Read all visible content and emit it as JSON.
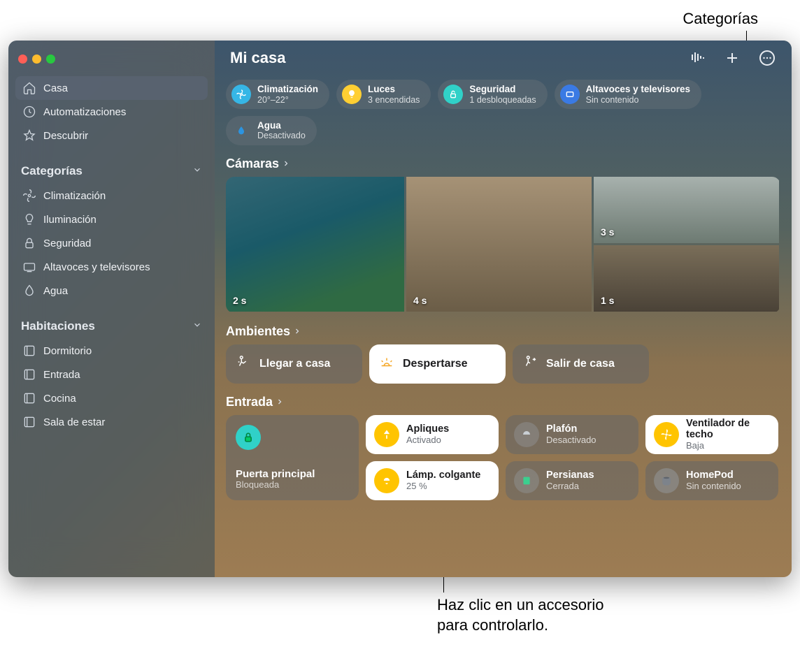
{
  "callouts": {
    "categories": "Categorías",
    "accessory": "Haz clic en un accesorio\npara controlarlo."
  },
  "header": {
    "title": "Mi casa"
  },
  "sidebar": {
    "nav": [
      {
        "label": "Casa",
        "icon": "home"
      },
      {
        "label": "Automatizaciones",
        "icon": "clock"
      },
      {
        "label": "Descubrir",
        "icon": "star"
      }
    ],
    "sections": {
      "cat_title": "Categorías",
      "rooms_title": "Habitaciones"
    },
    "categories": [
      {
        "label": "Climatización",
        "icon": "fan"
      },
      {
        "label": "Iluminación",
        "icon": "bulb"
      },
      {
        "label": "Seguridad",
        "icon": "lock"
      },
      {
        "label": "Altavoces y televisores",
        "icon": "tv"
      },
      {
        "label": "Agua",
        "icon": "drop"
      }
    ],
    "rooms": [
      {
        "label": "Dormitorio"
      },
      {
        "label": "Entrada"
      },
      {
        "label": "Cocina"
      },
      {
        "label": "Sala de estar"
      }
    ]
  },
  "chips": [
    {
      "title": "Climatización",
      "sub": "20°–22°",
      "icon": "fan",
      "color": "#36b6e6"
    },
    {
      "title": "Luces",
      "sub": "3 encendidas",
      "icon": "bulb",
      "color": "#ffcc33"
    },
    {
      "title": "Seguridad",
      "sub": "1 desbloqueadas",
      "icon": "lock",
      "color": "#30d1c8"
    },
    {
      "title": "Altavoces y televisores",
      "sub": "Sin contenido",
      "icon": "tv",
      "color": "#3a7ae4"
    },
    {
      "title": "Agua",
      "sub": "Desactivado",
      "icon": "drop",
      "color": "#2c94e0"
    }
  ],
  "sections": {
    "cameras": "Cámaras",
    "scenes": "Ambientes",
    "room": "Entrada"
  },
  "cameras": {
    "pool": "2 s",
    "street": "3 s",
    "bedroom": "1 s",
    "living": "4 s"
  },
  "scenes": [
    {
      "label": "Llegar a casa",
      "icon": "home-walk",
      "active": false
    },
    {
      "label": "Despertarse",
      "icon": "sunrise",
      "active": true
    },
    {
      "label": "Salir de casa",
      "icon": "walk-out",
      "active": false
    }
  ],
  "tiles": {
    "door": {
      "title": "Puerta principal",
      "sub": "Bloqueada"
    },
    "sconce": {
      "title": "Apliques",
      "sub": "Activado"
    },
    "ceiling": {
      "title": "Plafón",
      "sub": "Desactivado"
    },
    "fan": {
      "title": "Ventilador de techo",
      "sub": "Baja"
    },
    "pendant": {
      "title": "Lámp. colgante",
      "sub": "25 %"
    },
    "blinds": {
      "title": "Persianas",
      "sub": "Cerrada"
    },
    "homepod": {
      "title": "HomePod",
      "sub": "Sin contenido"
    }
  }
}
